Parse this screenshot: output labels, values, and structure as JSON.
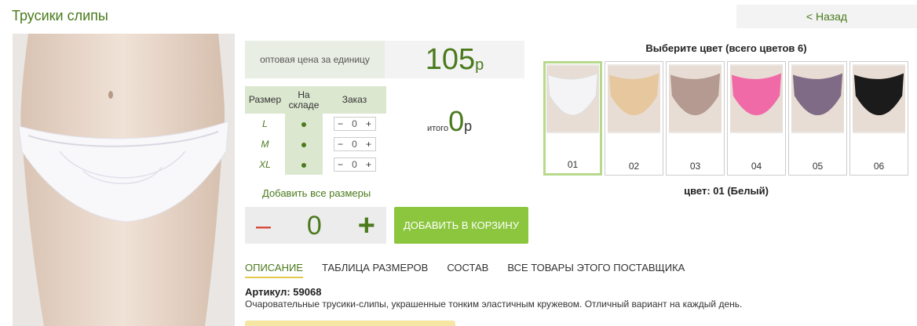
{
  "title": "Трусики слипы",
  "back_label": "< Назад",
  "price": {
    "label": "оптовая цена за единицу",
    "value": "105",
    "currency": "р"
  },
  "size_table": {
    "headers": [
      "Размер",
      "На складе",
      "Заказ"
    ],
    "rows": [
      {
        "size": "L",
        "qty": "0"
      },
      {
        "size": "M",
        "qty": "0"
      },
      {
        "size": "XL",
        "qty": "0"
      }
    ]
  },
  "total": {
    "label": "итого",
    "value": "0",
    "currency": "р"
  },
  "add_all_label": "Добавить все размеры",
  "quantity": {
    "value": "0",
    "minus": "–",
    "plus": "+"
  },
  "cart_button": "ДОБАВИТЬ В КОРЗИНУ",
  "tabs": [
    "ОПИСАНИЕ",
    "ТАБЛИЦА РАЗМЕРОВ",
    "СОСТАВ",
    "ВСЕ ТОВАРЫ ЭТОГО ПОСТАВЩИКА"
  ],
  "article": "Артикул: 59068",
  "description": "Очаровательные трусики-слипы, украшенные тонким эластичным кружевом. Отличный вариант на каждый день.",
  "colors": {
    "title": "Выберите цвет (всего цветов 6)",
    "selected": "цвет: 01 (Белый)",
    "items": [
      {
        "num": "01",
        "color": "#f4f4f6"
      },
      {
        "num": "02",
        "color": "#e6c79e"
      },
      {
        "num": "03",
        "color": "#b49a90"
      },
      {
        "num": "04",
        "color": "#f06aa8"
      },
      {
        "num": "05",
        "color": "#7f6b86"
      },
      {
        "num": "06",
        "color": "#1b1b1b"
      }
    ]
  },
  "accent_color": "#4a7a1c",
  "button_color": "#8cc63f"
}
